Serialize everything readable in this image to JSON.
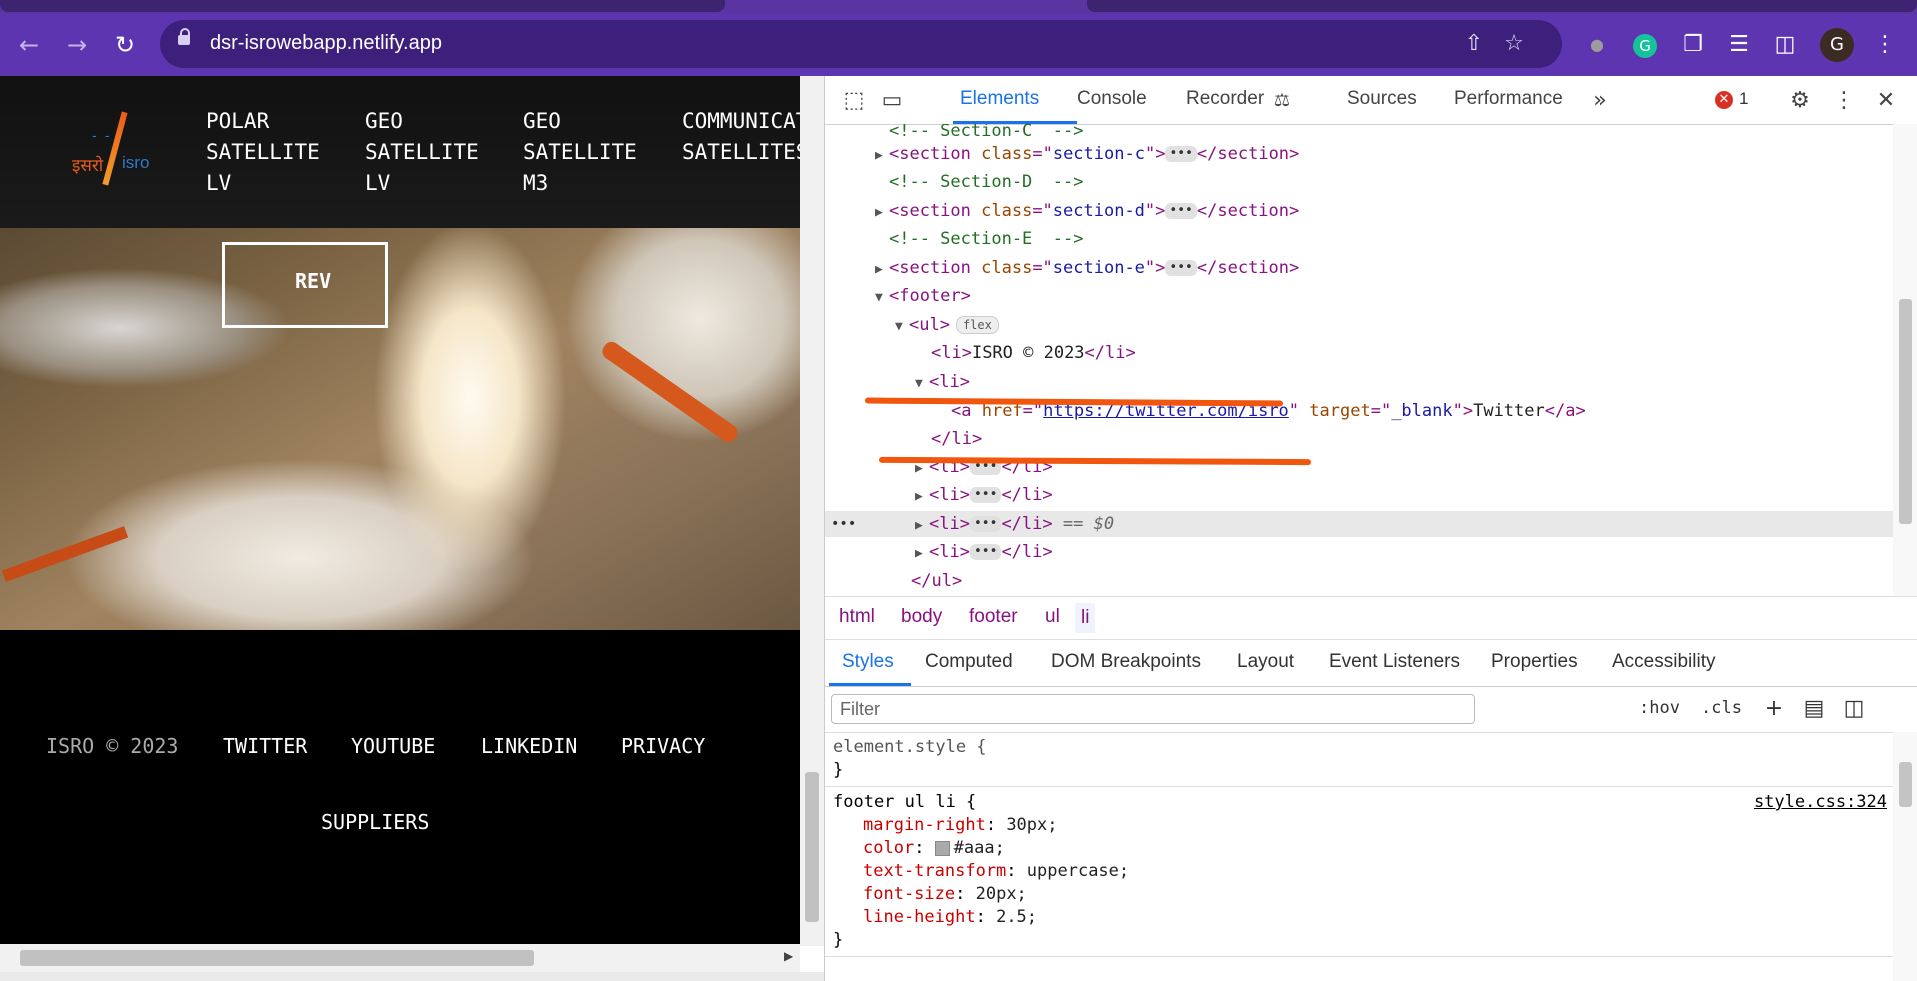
{
  "browser": {
    "url": "dsr-isrowebapp.netlify.app",
    "avatar_letter": "G",
    "back_icon": "arrow-left-icon",
    "forward_icon": "arrow-right-icon",
    "reload_icon": "reload-icon"
  },
  "site": {
    "logo_hindi": "इसरो",
    "logo_en": "isro",
    "nav": [
      {
        "label": "POLAR\nSATELLITE\nLV"
      },
      {
        "label": "GEO\nSATELLITE\nLV"
      },
      {
        "label": "GEO\nSATELLITE\nM3"
      },
      {
        "label": "COMMUNICATI\nSATELLITES"
      }
    ],
    "hero_button": "REV",
    "footer": [
      "ISRO © 2023",
      "TWITTER",
      "YOUTUBE",
      "LINKEDIN",
      "PRIVACY",
      "SUPPLIERS"
    ],
    "footer_colors": {
      "first": "#aaaaaa",
      "rest": "#ffffff"
    }
  },
  "devtools": {
    "tabs": [
      "Elements",
      "Console",
      "Recorder",
      "Sources",
      "Performance"
    ],
    "active_tab": "Elements",
    "error_count": "1",
    "dom_lines": {
      "l1": "<!-- Section-C  -->",
      "l2_tag": "section",
      "l2_cls": "section-c",
      "l3": "<!-- Section-D  -->",
      "l4_cls": "section-d",
      "l5": "<!-- Section-E  -->",
      "l6_cls": "section-e",
      "l7": "<footer>",
      "l8": "<ul>",
      "l8_badge": "flex",
      "l9_text": "ISRO © 2023",
      "l10": "<li>",
      "l11_href": "https://twitter.com/isro",
      "l11_target": "_blank",
      "l11_text": "Twitter",
      "l12": "</li>",
      "l17": "</ul>",
      "sel_marker": "== $0"
    },
    "breadcrumbs": [
      "html",
      "body",
      "footer",
      "ul",
      "li"
    ],
    "styles_tabs": [
      "Styles",
      "Computed",
      "DOM Breakpoints",
      "Layout",
      "Event Listeners",
      "Properties",
      "Accessibility"
    ],
    "filter_placeholder": "Filter",
    "filter_hov": ":hov",
    "filter_cls": ".cls",
    "element_style": "element.style {",
    "rule_selector": "footer ul li {",
    "rule_source": "style.css:324",
    "rule_props": [
      {
        "name": "margin-right",
        "value": "30px;"
      },
      {
        "name": "color",
        "value": "#aaa;"
      },
      {
        "name": "text-transform",
        "value": "uppercase;"
      },
      {
        "name": "font-size",
        "value": "20px;"
      },
      {
        "name": "line-height",
        "value": "2.5;"
      }
    ],
    "closing_brace": "}"
  },
  "colors": {
    "browser_frame": "#5e35b1",
    "devtools_accent": "#1a73e8",
    "annotation": "#f0560e"
  }
}
